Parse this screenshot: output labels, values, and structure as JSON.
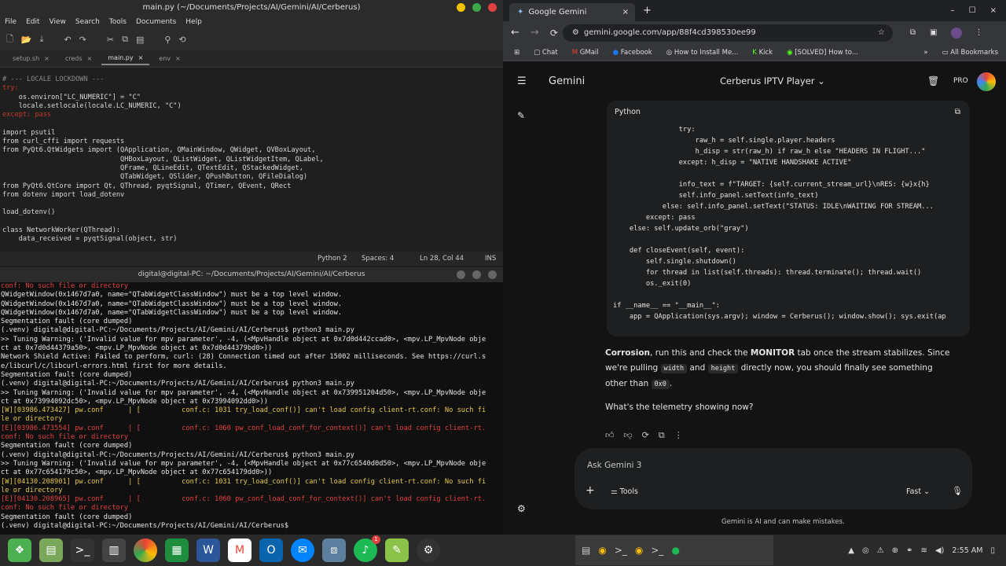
{
  "editor": {
    "title": "main.py (~/Documents/Projects/AI/Gemini/AI/Cerberus)",
    "menu": [
      "File",
      "Edit",
      "View",
      "Search",
      "Tools",
      "Documents",
      "Help"
    ],
    "tabs": [
      "setup.sh",
      "creds",
      "main.py",
      "env"
    ],
    "code": [
      {
        "t": "# --- LOCALE LOCKDOWN ---",
        "c": "cm"
      },
      {
        "t": "try:",
        "c": "rd"
      },
      {
        "t": "    os.environ[\"LC_NUMERIC\"] = \"C\"",
        "c": ""
      },
      {
        "t": "    locale.setlocale(locale.LC_NUMERIC, \"C\")",
        "c": ""
      },
      {
        "t": "except: pass",
        "c": "rd"
      },
      {
        "t": "",
        "c": ""
      },
      {
        "t": "import psutil",
        "c": ""
      },
      {
        "t": "from curl_cffi import requests",
        "c": ""
      },
      {
        "t": "from PyQt6.QtWidgets import (QApplication, QMainWindow, QWidget, QVBoxLayout,",
        "c": ""
      },
      {
        "t": "                             QHBoxLayout, QListWidget, QListWidgetItem, QLabel,",
        "c": ""
      },
      {
        "t": "                             QFrame, QLineEdit, QTextEdit, QStackedWidget,",
        "c": ""
      },
      {
        "t": "                             QTabWidget, QSlider, QPushButton, QFileDialog)",
        "c": ""
      },
      {
        "t": "from PyQt6.QtCore import Qt, QThread, pyqtSignal, QTimer, QEvent, QRect",
        "c": ""
      },
      {
        "t": "from dotenv import load_dotenv",
        "c": ""
      },
      {
        "t": "",
        "c": ""
      },
      {
        "t": "load_dotenv()",
        "c": ""
      },
      {
        "t": "",
        "c": ""
      },
      {
        "t": "class NetworkWorker(QThread):",
        "c": ""
      },
      {
        "t": "    data_received = pyqtSignal(object, str)",
        "c": ""
      }
    ],
    "status": {
      "language": "Python 2",
      "spaces": "Spaces: 4",
      "position": "Ln 28, Col 44",
      "mode": "INS"
    }
  },
  "terminal": {
    "title": "digital@digital-PC: ~/Documents/Projects/AI/Gemini/AI/Cerberus",
    "lines": [
      {
        "t": "conf: No such file or directory",
        "c": "tred"
      },
      {
        "t": "QWidgetWindow(0x1467d7a0, name=\"QTabWidgetClassWindow\") must be a top level window.",
        "c": ""
      },
      {
        "t": "QWidgetWindow(0x1467d7a0, name=\"QTabWidgetClassWindow\") must be a top level window.",
        "c": ""
      },
      {
        "t": "QWidgetWindow(0x1467d7a0, name=\"QTabWidgetClassWindow\") must be a top level window.",
        "c": ""
      },
      {
        "t": "Segmentation fault (core dumped)",
        "c": ""
      },
      {
        "t": "(.venv) digital@digital-PC:~/Documents/Projects/AI/Gemini/AI/Cerberus$ python3 main.py",
        "c": ""
      },
      {
        "t": ">> Tuning Warning: ('Invalid value for mpv parameter', -4, (<MpvHandle object at 0x7d0d442ccad0>, <mpv.LP_MpvNode obje",
        "c": ""
      },
      {
        "t": "ct at 0x7d0d44379a50>, <mpv.LP_MpvNode object at 0x7d0d44379bd0>))",
        "c": ""
      },
      {
        "t": "Network Shield Active: Failed to perform, curl: (28) Connection timed out after 15002 milliseconds. See https://curl.s",
        "c": ""
      },
      {
        "t": "e/libcurl/c/libcurl-errors.html first for more details.",
        "c": ""
      },
      {
        "t": "Segmentation fault (core dumped)",
        "c": ""
      },
      {
        "t": "(.venv) digital@digital-PC:~/Documents/Projects/AI/Gemini/AI/Cerberus$ python3 main.py",
        "c": ""
      },
      {
        "t": ">> Tuning Warning: ('Invalid value for mpv parameter', -4, (<MpvHandle object at 0x739951204d50>, <mpv.LP_MpvNode obje",
        "c": ""
      },
      {
        "t": "ct at 0x73994092dc50>, <mpv.LP_MpvNode object at 0x73994092dd0>))",
        "c": ""
      },
      {
        "t": "[W][03986.473427] pw.conf      | [          conf.c: 1031 try_load_conf()] can't load config client-rt.conf: No such fi",
        "c": "tylw"
      },
      {
        "t": "le or directory",
        "c": "tylw"
      },
      {
        "t": "[E][03986.473554] pw.conf      | [          conf.c: 1060 pw_conf_load_conf_for_context()] can't load config client-rt.",
        "c": "tred"
      },
      {
        "t": "conf: No such file or directory",
        "c": "tred"
      },
      {
        "t": "Segmentation fault (core dumped)",
        "c": ""
      },
      {
        "t": "(.venv) digital@digital-PC:~/Documents/Projects/AI/Gemini/AI/Cerberus$ python3 main.py",
        "c": ""
      },
      {
        "t": ">> Tuning Warning: ('Invalid value for mpv parameter', -4, (<MpvHandle object at 0x77c6540d0d50>, <mpv.LP_MpvNode obje",
        "c": ""
      },
      {
        "t": "ct at 0x77c654179c50>, <mpv.LP_MpvNode object at 0x77c654179dd0>))",
        "c": ""
      },
      {
        "t": "[W][04130.208901] pw.conf      | [          conf.c: 1031 try_load_conf()] can't load config client-rt.conf: No such fi",
        "c": "tylw"
      },
      {
        "t": "le or directory",
        "c": "tylw"
      },
      {
        "t": "[E][04130.208965] pw.conf      | [          conf.c: 1060 pw_conf_load_conf_for_context()] can't load config client-rt.",
        "c": "tred"
      },
      {
        "t": "conf: No such file or directory",
        "c": "tred"
      },
      {
        "t": "Segmentation fault (core dumped)",
        "c": ""
      },
      {
        "t": "(.venv) digital@digital-PC:~/Documents/Projects/AI/Gemini/AI/Cerberus$ ",
        "c": ""
      }
    ]
  },
  "browser": {
    "tab_title": "Google Gemini",
    "url": "gemini.google.com/app/88f4cd398530ee99",
    "bookmarks": [
      "Chat",
      "GMail",
      "Facebook",
      "How to Install Me...",
      "Kick",
      "[SOLVED] How to..."
    ],
    "all_bookmarks": "All Bookmarks"
  },
  "gemini": {
    "brand": "Gemini",
    "conversation": "Cerberus IPTV Player",
    "badge": "PRO",
    "code_lang": "Python",
    "code_lines": [
      "                try:",
      "                    raw_h = self.single.player.headers",
      "                    h_disp = str(raw_h) if raw_h else \"HEADERS IN FLIGHT...\"",
      "                except: h_disp = \"NATIVE HANDSHAKE ACTIVE\"",
      "",
      "                info_text = f\"TARGET: {self.current_stream_url}\\nRES: {w}x{h}",
      "                self.info_panel.setText(info_text)",
      "            else: self.info_panel.setText(\"STATUS: IDLE\\nWAITING FOR STREAM...",
      "        except: pass",
      "    else: self.update_orb(\"gray\")",
      "",
      "    def closeEvent(self, event):",
      "        self.single.shutdown()",
      "        for thread in list(self.threads): thread.terminate(); thread.wait()",
      "        os._exit(0)",
      "",
      "if __name__ == \"__main__\":",
      "    app = QApplication(sys.argv); window = Cerberus(); window.show(); sys.exit(ap"
    ],
    "answer": {
      "name": "Corrosion",
      "p1a": ", run this and check the ",
      "p1b": "MONITOR",
      "p1c": " tab once the stream stabilizes. Since we're pulling ",
      "code1": "width",
      "p1d": " and ",
      "code2": "height",
      "p1e": " directly now, you should finally see something other than ",
      "code3": "0x0",
      "p1f": ".",
      "p2": "What's the telemetry showing now?"
    },
    "input_placeholder": "Ask Gemini 3",
    "tools_label": "Tools",
    "mode_label": "Fast",
    "disclaimer": "Gemini is AI and can make mistakes."
  },
  "taskbar": {
    "time": "2:55 AM",
    "badge_count": "1"
  },
  "colors": {
    "red": "#e04040",
    "yellow": "#f2c200",
    "green": "#3aa845"
  }
}
